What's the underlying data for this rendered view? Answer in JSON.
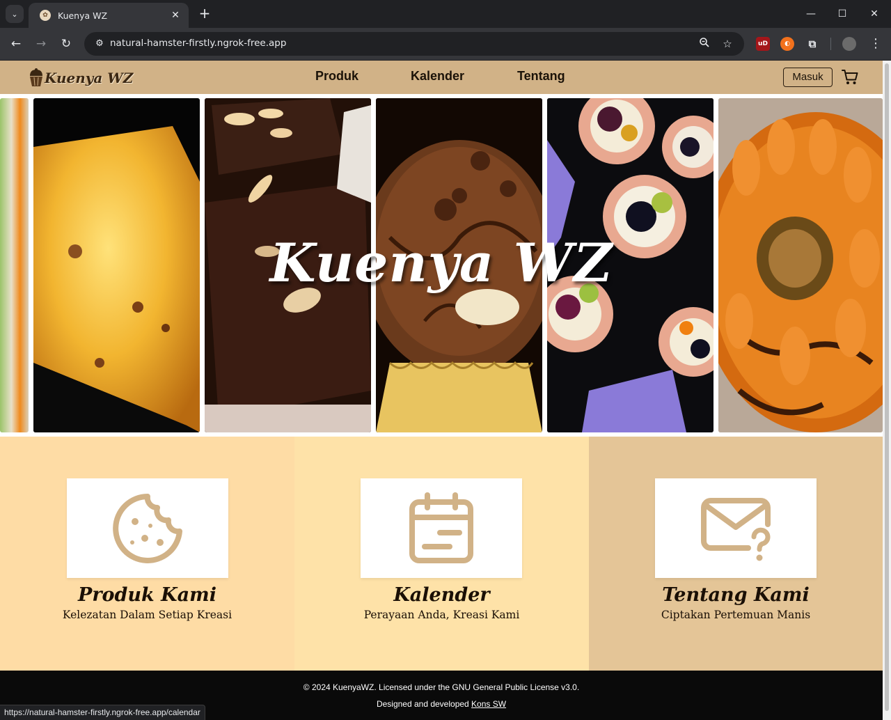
{
  "browser": {
    "tab_title": "Kuenya WZ",
    "url": "natural-hamster-firstly.ngrok-free.app",
    "status_url": "https://natural-hamster-firstly.ngrok-free.app/calendar"
  },
  "site": {
    "logo_text": "Kuenya WZ",
    "nav": {
      "produk": "Produk",
      "kalender": "Kalender",
      "tentang": "Tentang"
    },
    "login_label": "Masuk",
    "hero_title": "Kuenya WZ"
  },
  "features": [
    {
      "title": "Produk Kami",
      "subtitle": "Kelezatan Dalam Setiap Kreasi",
      "icon": "cookie-icon",
      "bg": "#fedca5"
    },
    {
      "title": "Kalender",
      "subtitle": "Perayaan Anda, Kreasi Kami",
      "icon": "calendar-icon",
      "bg": "#fee2a8"
    },
    {
      "title": "Tentang Kami",
      "subtitle": "Ciptakan Pertemuan Manis",
      "icon": "mail-question-icon",
      "bg": "#e4c597"
    }
  ],
  "footer": {
    "license": "© 2024 KuenyaWZ. Licensed under the GNU General Public License v3.0.",
    "designed_prefix": "Designed and developed ",
    "designed_link": "Kons SW"
  },
  "colors": {
    "navbar": "#d1b287",
    "icon": "#d1b287",
    "footer": "#0a0a0a"
  }
}
